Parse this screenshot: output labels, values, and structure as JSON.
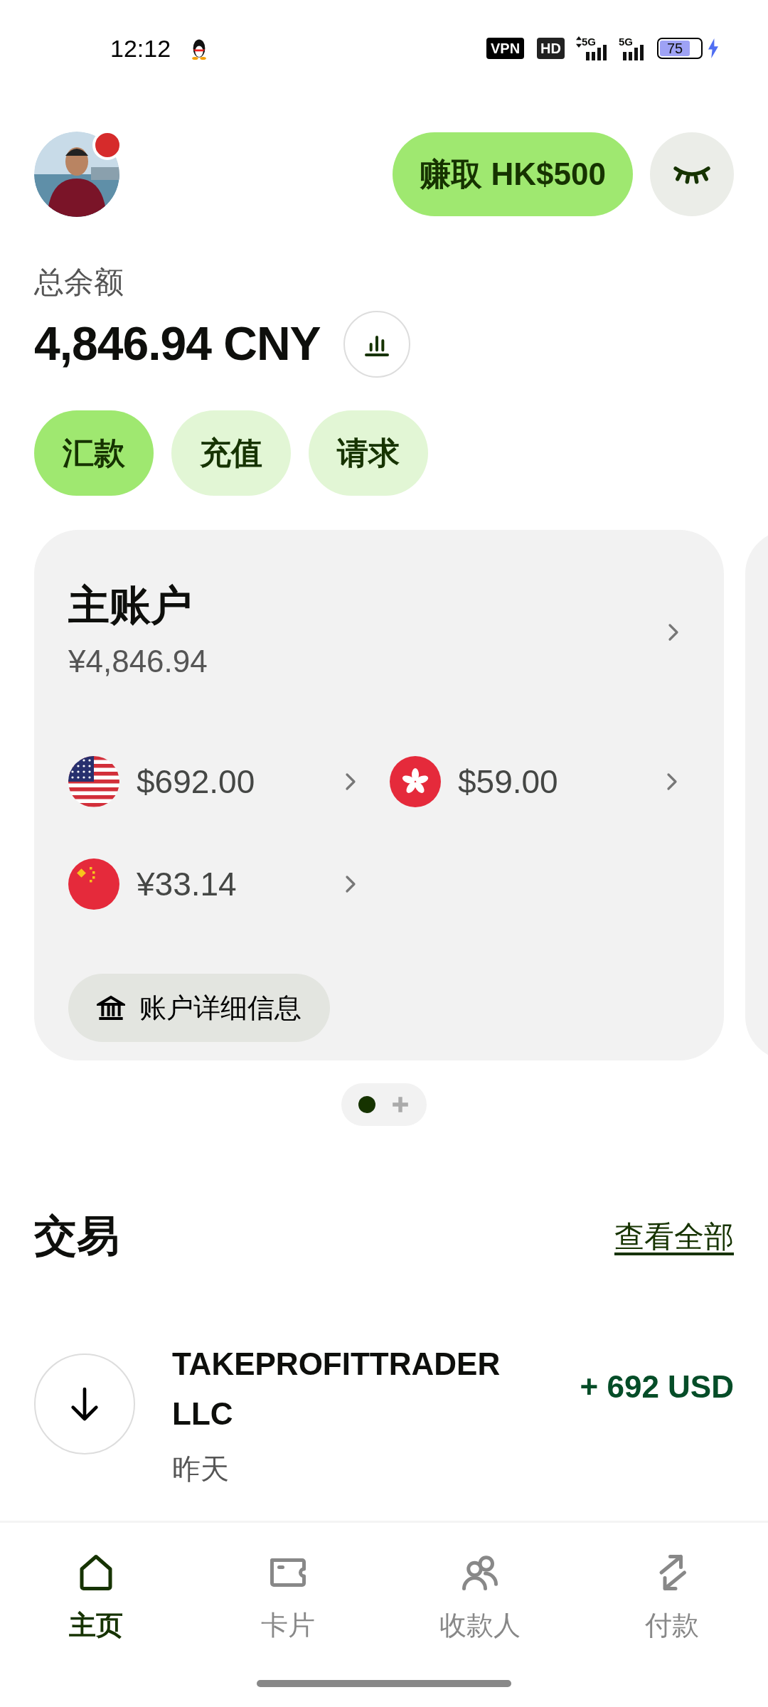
{
  "status_bar": {
    "time": "12:12",
    "vpn": "VPN",
    "hd": "HD",
    "signals": [
      {
        "label": "5G",
        "kind": "arrows"
      },
      {
        "label": "5G",
        "kind": "plain"
      }
    ],
    "battery": "75",
    "charging": true
  },
  "header": {
    "avatar": {
      "kind": "picture",
      "notification": true
    },
    "promo_button": "赚取 HK$500",
    "hide_balance": true
  },
  "balance": {
    "label": "总余额",
    "amount": "4,846.94 CNY"
  },
  "actions": [
    {
      "label": "汇款",
      "primary": true
    },
    {
      "label": "充值",
      "primary": false
    },
    {
      "label": "请求",
      "primary": false
    }
  ],
  "account_card": {
    "title": "主账户",
    "amount": "¥4,846.94",
    "currencies": [
      {
        "kind": "us",
        "amount": "$692.00"
      },
      {
        "kind": "hk",
        "amount": "$59.00"
      },
      {
        "kind": "cn",
        "amount": "¥33.14"
      }
    ],
    "details_button": "账户详细信息"
  },
  "pager": [
    {
      "kind": "dot",
      "selected": true
    },
    {
      "kind": "add",
      "selected": false
    }
  ],
  "transactions": {
    "title": "交易",
    "see_all": "查看全部",
    "items": [
      {
        "kind": "in",
        "name": "TAKEPROFITTRADER LLC",
        "date": "昨天",
        "amount": "+ 692 USD"
      }
    ]
  },
  "bottom_nav": [
    {
      "kind": "home",
      "label": "主页",
      "selected": true
    },
    {
      "kind": "card",
      "label": "卡片",
      "selected": false
    },
    {
      "kind": "people",
      "label": "收款人",
      "selected": false
    },
    {
      "kind": "transfer",
      "label": "付款",
      "selected": false
    }
  ]
}
